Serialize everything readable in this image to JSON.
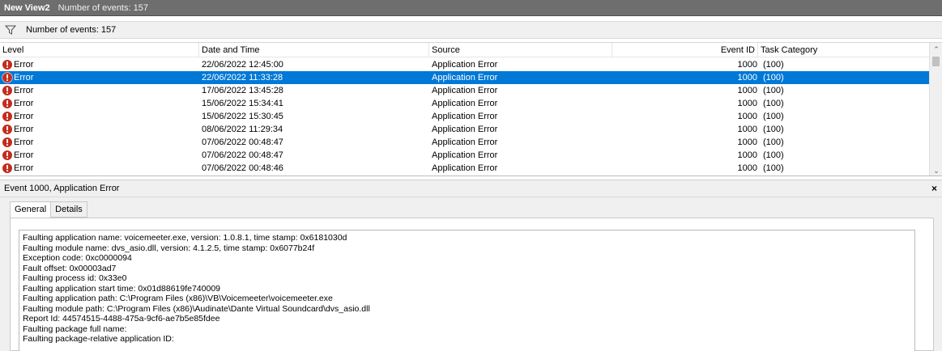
{
  "window": {
    "title": "New View2",
    "count_text": "Number of events: 157"
  },
  "filter": {
    "text": "Number of events: 157",
    "icon": "filter-icon"
  },
  "grid": {
    "columns": [
      "Level",
      "Date and Time",
      "Source",
      "Event ID",
      "Task Category"
    ],
    "rows": [
      {
        "level": "Error",
        "date": "22/06/2022 12:45:00",
        "source": "Application Error",
        "event_id": "1000",
        "task": "(100)"
      },
      {
        "level": "Error",
        "date": "22/06/2022 11:33:28",
        "source": "Application Error",
        "event_id": "1000",
        "task": "(100)"
      },
      {
        "level": "Error",
        "date": "17/06/2022 13:45:28",
        "source": "Application Error",
        "event_id": "1000",
        "task": "(100)"
      },
      {
        "level": "Error",
        "date": "15/06/2022 15:34:41",
        "source": "Application Error",
        "event_id": "1000",
        "task": "(100)"
      },
      {
        "level": "Error",
        "date": "15/06/2022 15:30:45",
        "source": "Application Error",
        "event_id": "1000",
        "task": "(100)"
      },
      {
        "level": "Error",
        "date": "08/06/2022 11:29:34",
        "source": "Application Error",
        "event_id": "1000",
        "task": "(100)"
      },
      {
        "level": "Error",
        "date": "07/06/2022 00:48:47",
        "source": "Application Error",
        "event_id": "1000",
        "task": "(100)"
      },
      {
        "level": "Error",
        "date": "07/06/2022 00:48:47",
        "source": "Application Error",
        "event_id": "1000",
        "task": "(100)"
      },
      {
        "level": "Error",
        "date": "07/06/2022 00:48:46",
        "source": "Application Error",
        "event_id": "1000",
        "task": "(100)"
      }
    ],
    "selected_index": 1
  },
  "detail": {
    "title": "Event 1000, Application Error",
    "close_label": "×",
    "tabs": [
      "General",
      "Details"
    ],
    "active_tab": 0,
    "description_lines": [
      "Faulting application name: voicemeeter.exe, version: 1.0.8.1, time stamp: 0x6181030d",
      "Faulting module name: dvs_asio.dll, version: 4.1.2.5, time stamp: 0x6077b24f",
      "Exception code: 0xc0000094",
      "Fault offset: 0x00003ad7",
      "Faulting process id: 0x33e0",
      "Faulting application start time: 0x01d88619fe740009",
      "Faulting application path: C:\\Program Files (x86)\\VB\\Voicemeeter\\voicemeeter.exe",
      "Faulting module path: C:\\Program Files (x86)\\Audinate\\Dante Virtual Soundcard\\dvs_asio.dll",
      "Report Id: 44574515-4488-475a-9cf6-ae7b5e85fdee",
      "Faulting package full name: ",
      "Faulting package-relative application ID: "
    ]
  },
  "colors": {
    "selection": "#0078d7",
    "error_icon": "#c42b1c",
    "titlebar": "#6e6e6e"
  }
}
